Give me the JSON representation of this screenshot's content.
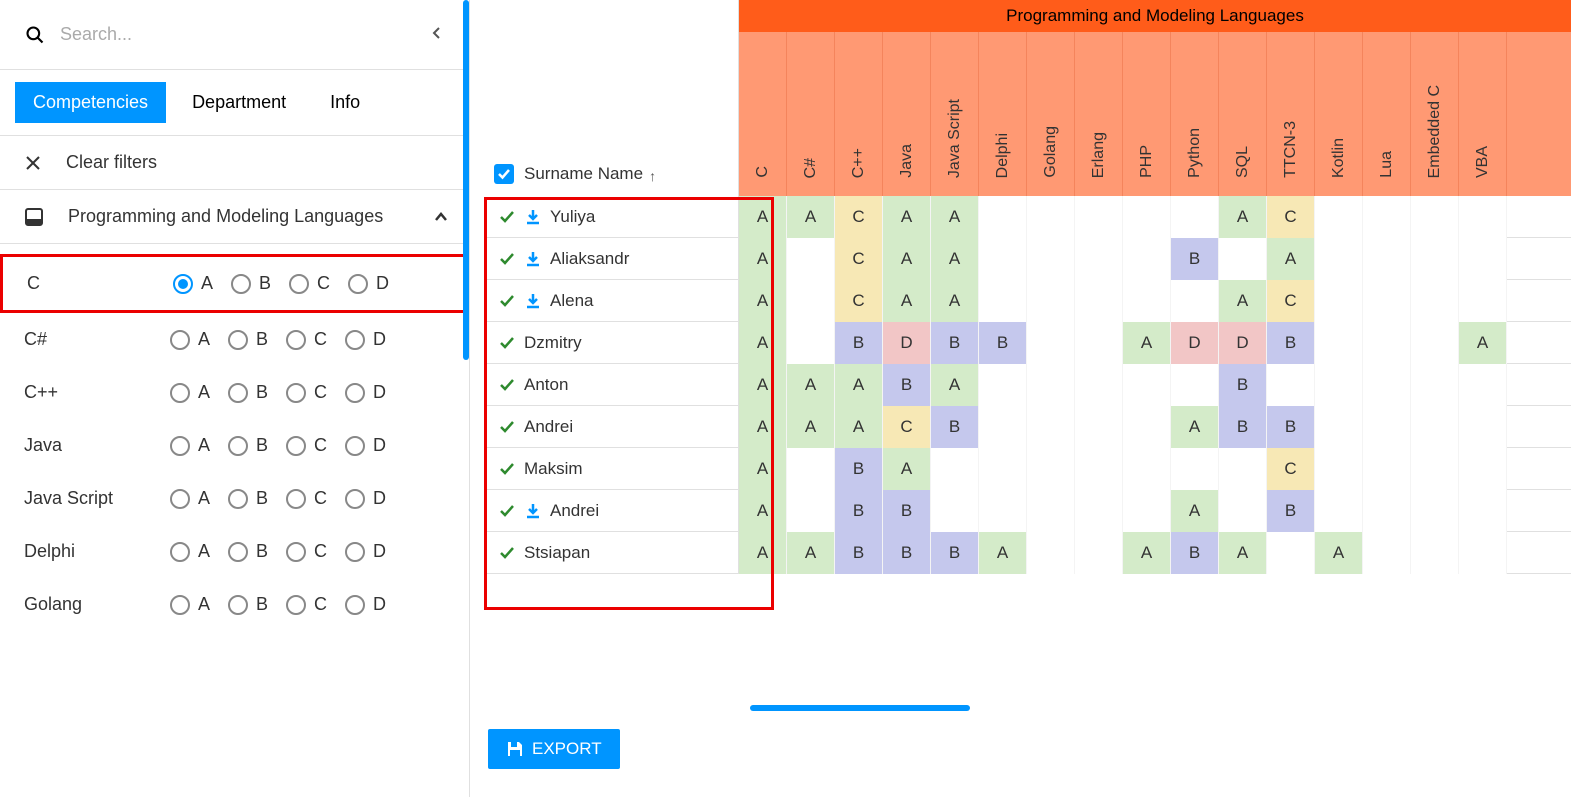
{
  "search": {
    "placeholder": "Search..."
  },
  "tabs": [
    {
      "label": "Competencies",
      "active": true
    },
    {
      "label": "Department",
      "active": false
    },
    {
      "label": "Info",
      "active": false
    }
  ],
  "clear_label": "Clear filters",
  "group_title": "Programming and Modeling Languages",
  "filter_grades": [
    "A",
    "B",
    "C",
    "D"
  ],
  "filters": [
    {
      "name": "C",
      "selected": "A",
      "highlighted": true
    },
    {
      "name": "C#",
      "selected": null
    },
    {
      "name": "C++",
      "selected": null
    },
    {
      "name": "Java",
      "selected": null
    },
    {
      "name": "Java Script",
      "selected": null
    },
    {
      "name": "Delphi",
      "selected": null
    },
    {
      "name": "Golang",
      "selected": null
    }
  ],
  "matrix": {
    "title": "Programming and Modeling Languages",
    "name_header": "Surname Name",
    "sort_dir": "↑",
    "columns": [
      "C",
      "C#",
      "C++",
      "Java",
      "Java Script",
      "Delphi",
      "Golang",
      "Erlang",
      "PHP",
      "Python",
      "SQL",
      "TTCN-3",
      "Kotlin",
      "Lua",
      "Embedded C",
      "VBA"
    ],
    "rows": [
      {
        "name": "Yuliya",
        "dl": true,
        "cells": [
          "A",
          "A",
          "C",
          "A",
          "A",
          "",
          "",
          "",
          "",
          "",
          "A",
          "C",
          "",
          "",
          "",
          ""
        ]
      },
      {
        "name": "Aliaksandr",
        "dl": true,
        "cells": [
          "A",
          "",
          "C",
          "A",
          "A",
          "",
          "",
          "",
          "",
          "B",
          "",
          "A",
          "",
          "",
          "",
          ""
        ]
      },
      {
        "name": "Alena",
        "dl": true,
        "cells": [
          "A",
          "",
          "C",
          "A",
          "A",
          "",
          "",
          "",
          "",
          "",
          "A",
          "C",
          "",
          "",
          "",
          ""
        ]
      },
      {
        "name": "Dzmitry",
        "dl": false,
        "cells": [
          "A",
          "",
          "B",
          "D",
          "B",
          "B",
          "",
          "",
          "A",
          "D",
          "D",
          "B",
          "",
          "",
          "",
          "A"
        ]
      },
      {
        "name": "Anton",
        "dl": false,
        "cells": [
          "A",
          "A",
          "A",
          "B",
          "A",
          "",
          "",
          "",
          "",
          "",
          "B",
          "",
          "",
          "",
          "",
          ""
        ]
      },
      {
        "name": "Andrei",
        "dl": false,
        "cells": [
          "A",
          "A",
          "A",
          "C",
          "B",
          "",
          "",
          "",
          "",
          "A",
          "B",
          "B",
          "",
          "",
          "",
          ""
        ]
      },
      {
        "name": "Maksim",
        "dl": false,
        "cells": [
          "A",
          "",
          "B",
          "A",
          "",
          "",
          "",
          "",
          "",
          "",
          "",
          "C",
          "",
          "",
          "",
          ""
        ]
      },
      {
        "name": "Andrei",
        "dl": true,
        "cells": [
          "A",
          "",
          "B",
          "B",
          "",
          "",
          "",
          "",
          "",
          "A",
          "",
          "B",
          "",
          "",
          "",
          ""
        ]
      },
      {
        "name": "Stsiapan",
        "dl": false,
        "cells": [
          "A",
          "A",
          "B",
          "B",
          "B",
          "A",
          "",
          "",
          "A",
          "B",
          "A",
          "",
          "A",
          "",
          "",
          ""
        ]
      }
    ]
  },
  "export_label": "EXPORT"
}
